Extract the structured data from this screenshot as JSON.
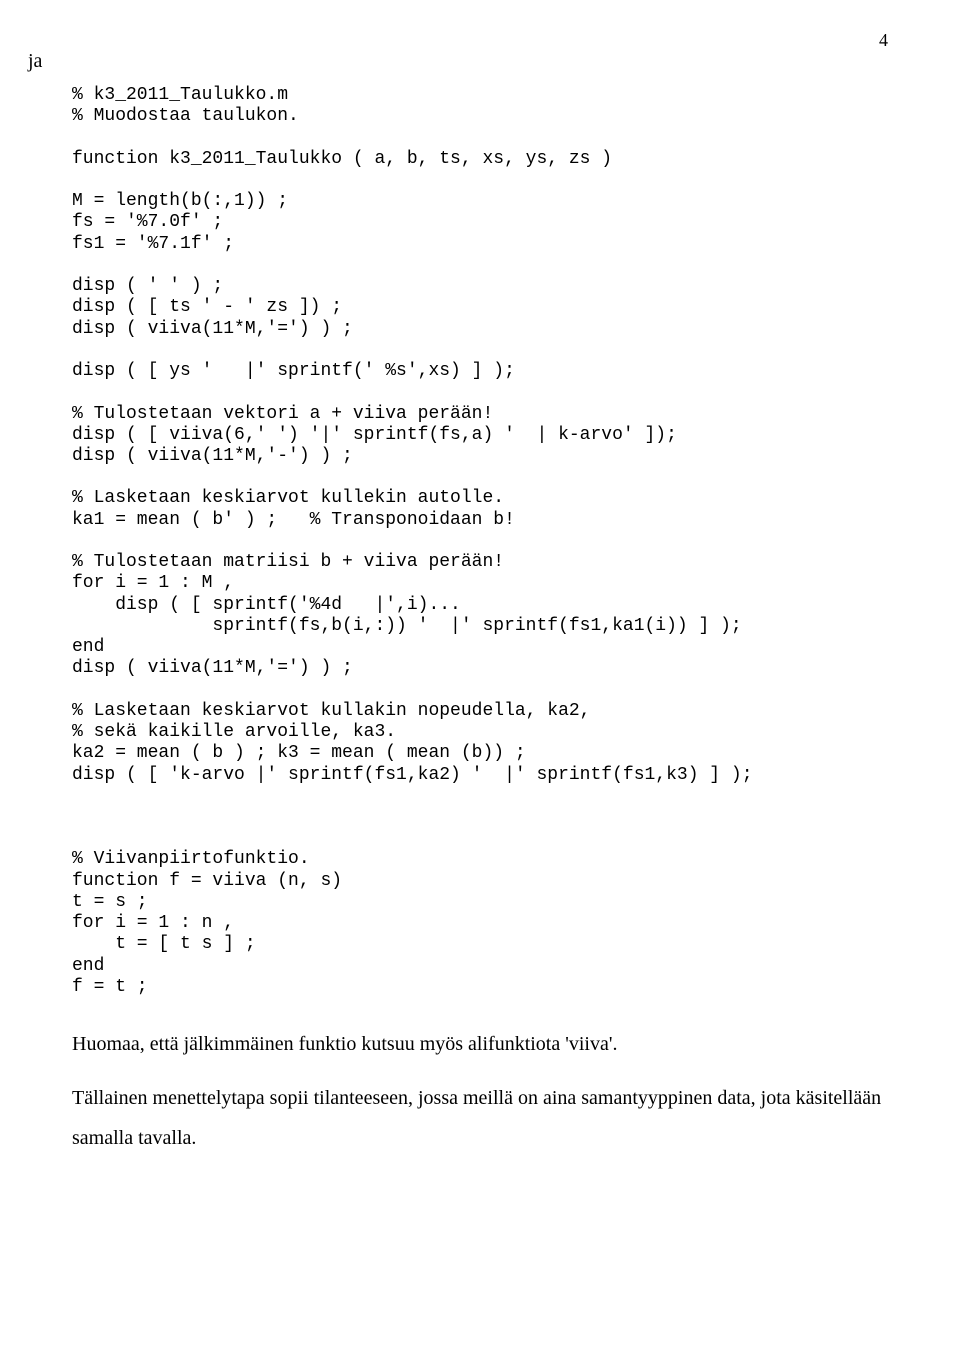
{
  "page_number": "4",
  "marker": "ja",
  "code": "% k3_2011_Taulukko.m\n% Muodostaa taulukon.\n\nfunction k3_2011_Taulukko ( a, b, ts, xs, ys, zs )\n\nM = length(b(:,1)) ;\nfs = '%7.0f' ;\nfs1 = '%7.1f' ;\n\ndisp ( ' ' ) ;\ndisp ( [ ts ' - ' zs ]) ;\ndisp ( viiva(11*M,'=') ) ;\n\ndisp ( [ ys '   |' sprintf(' %s',xs) ] );\n\n% Tulostetaan vektori a + viiva perään!\ndisp ( [ viiva(6,' ') '|' sprintf(fs,a) '  | k-arvo' ]);\ndisp ( viiva(11*M,'-') ) ;\n\n% Lasketaan keskiarvot kullekin autolle.\nka1 = mean ( b' ) ;   % Transponoidaan b!\n\n% Tulostetaan matriisi b + viiva perään!\nfor i = 1 : M ,\n    disp ( [ sprintf('%4d   |',i)...\n             sprintf(fs,b(i,:)) '  |' sprintf(fs1,ka1(i)) ] );\nend\ndisp ( viiva(11*M,'=') ) ;\n\n% Lasketaan keskiarvot kullakin nopeudella, ka2,\n% sekä kaikille arvoille, ka3.\nka2 = mean ( b ) ; k3 = mean ( mean (b)) ;\ndisp ( [ 'k-arvo |' sprintf(fs1,ka2) '  |' sprintf(fs1,k3) ] );\n\n\n\n% Viivanpiirtofunktio.\nfunction f = viiva (n, s)\nt = s ;\nfor i = 1 : n ,\n    t = [ t s ] ;\nend\nf = t ;",
  "para1": "Huomaa, että jälkimmäinen funktio kutsuu myös alifunktiota 'viiva'.",
  "para2": "Tällainen menettelytapa sopii tilanteeseen, jossa meillä on aina samantyyppinen data, jota käsitellään samalla tavalla."
}
